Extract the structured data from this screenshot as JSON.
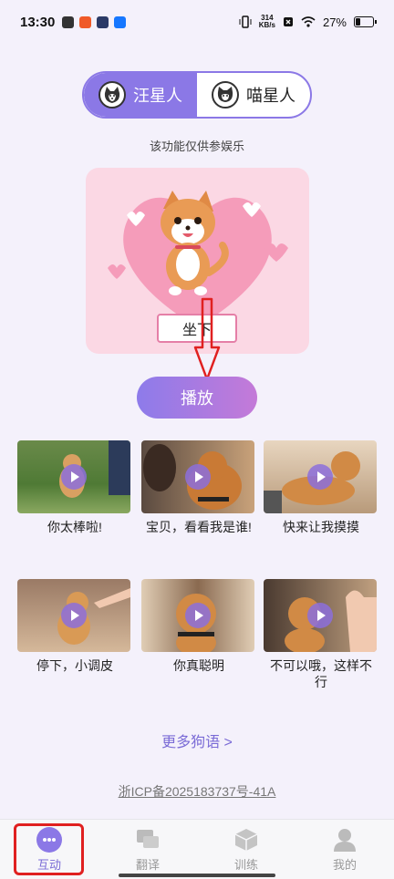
{
  "status_bar": {
    "time": "13:30",
    "net_speed_value": "314",
    "net_speed_unit": "KB/s",
    "battery": "27%"
  },
  "toggle": {
    "dog": "汪星人",
    "cat": "喵星人"
  },
  "disclaimer": "该功能仅供参娱乐",
  "hero": {
    "command_label": "坐下"
  },
  "play_button": "播放",
  "phrases": [
    {
      "caption": "你太棒啦!"
    },
    {
      "caption": "宝贝，看看我是谁!"
    },
    {
      "caption": "快来让我摸摸"
    },
    {
      "caption": "停下，小调皮"
    },
    {
      "caption": "你真聪明"
    },
    {
      "caption": "不可以哦，这样不行"
    }
  ],
  "more_link": "更多狗语 >",
  "icp": "浙ICP备2025183737号-41A",
  "nav": {
    "interact": "互动",
    "translate": "翻译",
    "train": "训练",
    "mine": "我的"
  },
  "colors": {
    "accent": "#8b78e6",
    "annotation": "#e02020",
    "hero_bg": "#fbd8e4"
  }
}
